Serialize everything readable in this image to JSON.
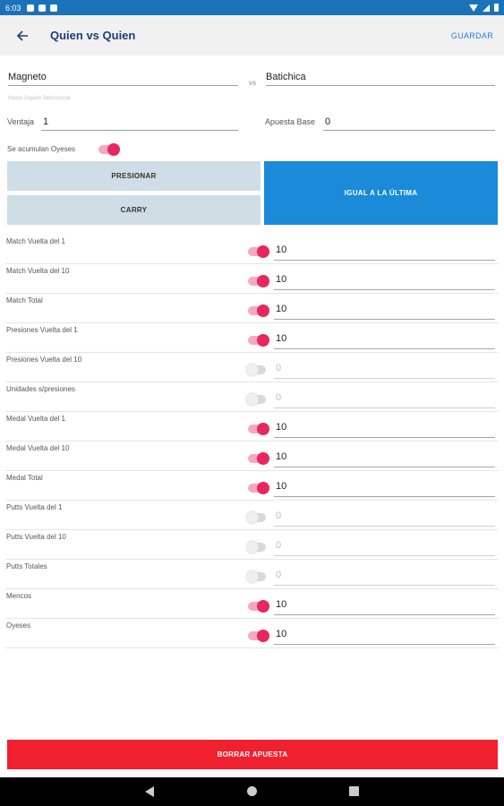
{
  "status": {
    "time": "6:03"
  },
  "appbar": {
    "title": "Quien vs Quien",
    "save_label": "GUARDAR"
  },
  "players": {
    "player1": "Magneto",
    "vs": "vs",
    "player2": "Batichica",
    "hint": "Hasta Jugado Seleccionar"
  },
  "ventaja": {
    "label": "Ventaja",
    "value": "1"
  },
  "apuesta_base": {
    "label": "Apuesta Base",
    "value": "0"
  },
  "acumulan": {
    "label": "Se acumulan Oyeses",
    "on": true
  },
  "buttons": {
    "presionar": "PRESIONAR",
    "carry": "CARRY",
    "igual": "IGUAL A LA ÚLTIMA"
  },
  "rows": [
    {
      "label": "Match Vuelta del 1",
      "on": true,
      "value": "10"
    },
    {
      "label": "Match Vuelta del 10",
      "on": true,
      "value": "10"
    },
    {
      "label": "Match Total",
      "on": true,
      "value": "10"
    },
    {
      "label": "Presiones Vuelta del 1",
      "on": true,
      "value": "10"
    },
    {
      "label": "Presiones Vuelta del 10",
      "on": false,
      "value": "0"
    },
    {
      "label": "Unidades s/presiones",
      "on": false,
      "value": "0"
    },
    {
      "label": "Medal Vuelta del 1",
      "on": true,
      "value": "10"
    },
    {
      "label": "Medal Vuelta del 10",
      "on": true,
      "value": "10"
    },
    {
      "label": "Medal Total",
      "on": true,
      "value": "10"
    },
    {
      "label": "Putts Vuelta del 1",
      "on": false,
      "value": "0"
    },
    {
      "label": "Putts Vuelta del 10",
      "on": false,
      "value": "0"
    },
    {
      "label": "Putts Totales",
      "on": false,
      "value": "0"
    },
    {
      "label": "Mencos",
      "on": true,
      "value": "10"
    },
    {
      "label": "Oyeses",
      "on": true,
      "value": "10"
    }
  ],
  "delete_label": "BORRAR APUESTA",
  "colors": {
    "status_bar": "#1a73b8",
    "accent_pink": "#e8265f",
    "primary_blue": "#1a8ad9",
    "danger_red": "#f1202f"
  }
}
